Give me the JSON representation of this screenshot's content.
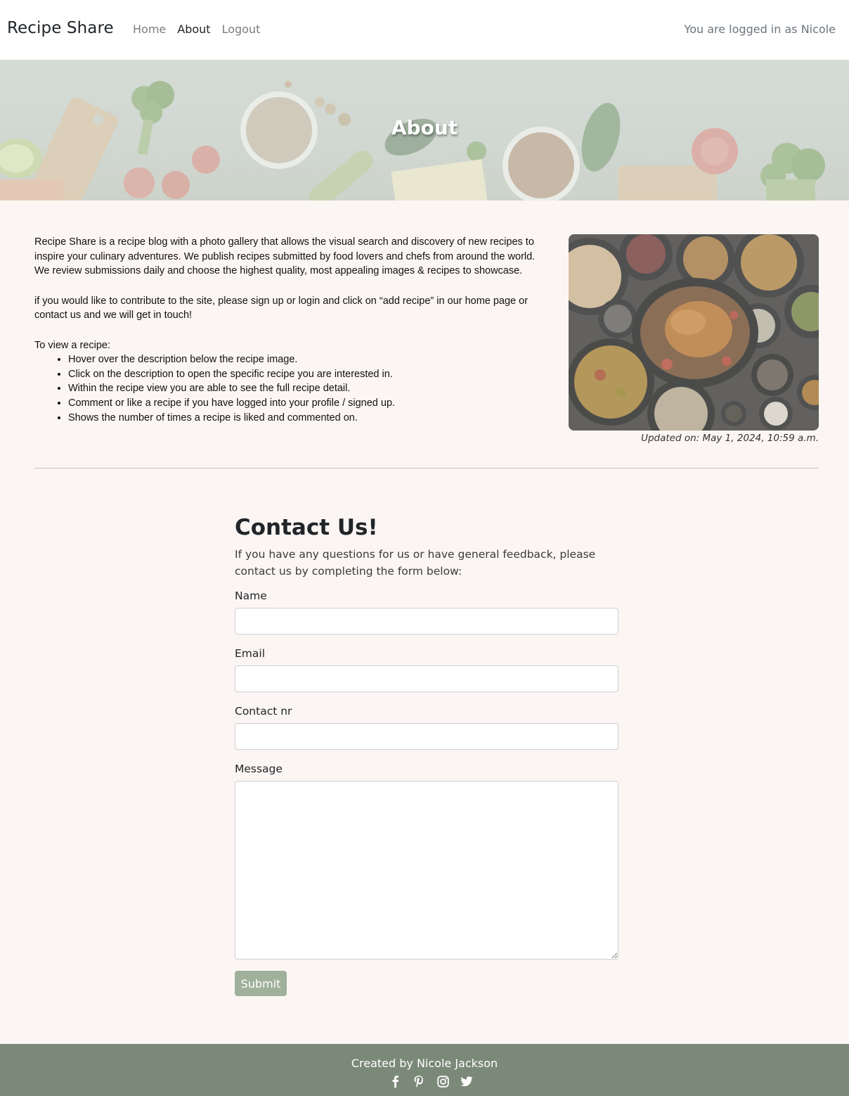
{
  "nav": {
    "brand": "Recipe Share",
    "links": [
      {
        "label": "Home",
        "active": false
      },
      {
        "label": "About",
        "active": true
      },
      {
        "label": "Logout",
        "active": false
      }
    ],
    "status": "You are logged in as Nicole"
  },
  "hero": {
    "title": "About"
  },
  "about": {
    "paragraph_1": "Recipe Share is a recipe blog with a photo gallery that allows the visual search and discovery of new recipes to inspire your culinary adventures. We publish recipes submitted by food lovers and chefs from around the world. We review submissions daily and choose the highest quality, most appealing images & recipes to showcase.",
    "paragraph_2": "if you would like to contribute to the site, please sign up or login and click on “add recipe” in our home page or contact us and we will get in touch!",
    "view_heading": "To view a recipe:",
    "steps": [
      "Hover over the description below the recipe image.",
      "Click on the description to open the specific recipe you are interested in.",
      "Within the recipe view you are able to see the full recipe detail.",
      "Comment or like a recipe if you have logged into your profile / signed up.",
      "Shows the number of times a recipe is liked and commented on."
    ],
    "updated": "Updated on: May 1, 2024, 10:59 a.m."
  },
  "contact": {
    "heading": "Contact Us!",
    "intro": "If you have any questions for us or have general feedback, please contact us by completing the form below:",
    "fields": {
      "name_label": "Name",
      "email_label": "Email",
      "phone_label": "Contact nr",
      "message_label": "Message"
    },
    "submit_label": "Submit"
  },
  "footer": {
    "credit": "Created by Nicole Jackson",
    "socials": [
      "facebook-icon",
      "pinterest-icon",
      "instagram-icon",
      "twitter-icon"
    ]
  },
  "colors": {
    "page_bg": "#fbf6f3",
    "footer_bg": "#7b8978",
    "submit_bg": "#9fb09b"
  }
}
